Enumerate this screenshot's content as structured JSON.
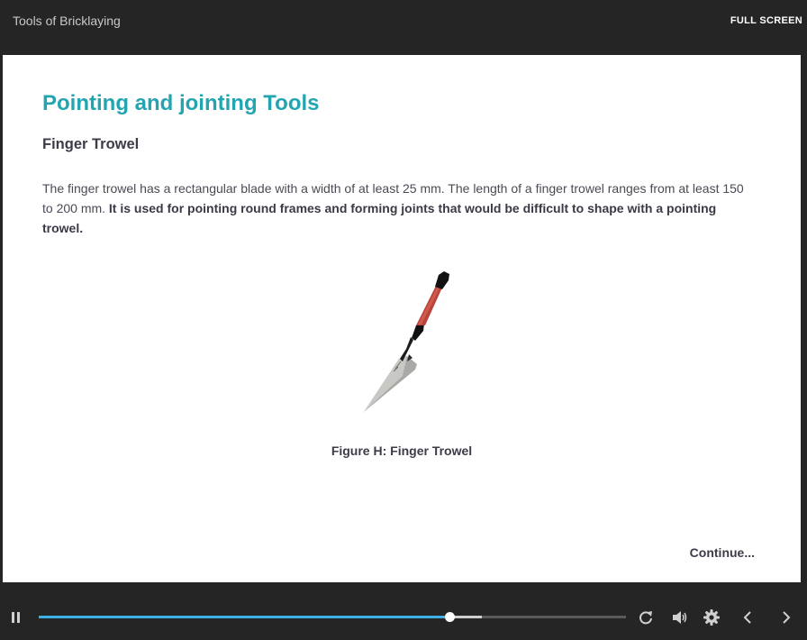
{
  "header": {
    "course_title": "Tools of Bricklaying",
    "fullscreen_label": "FULL SCREEN"
  },
  "slide": {
    "title": "Pointing and jointing Tools",
    "subtitle": "Finger Trowel",
    "body_plain": "The finger trowel has a rectangular blade with a width of at least 25 mm. The length of a finger trowel ranges from at least 150 to 200 mm. ",
    "body_bold": "It is used for pointing round frames and forming joints that would be difficult to shape with a pointing trowel.",
    "figure_caption": "Figure H: Finger Trowel",
    "continue_label": "Continue..."
  },
  "player": {
    "progress_fraction": 0.7,
    "buffered_fraction": 0.755,
    "icons": [
      "pause-icon",
      "replay-icon",
      "volume-icon",
      "settings-icon",
      "prev-icon",
      "next-icon"
    ]
  },
  "colors": {
    "accent_title": "#23a5b1",
    "progress": "#3db1e3",
    "chrome_bg": "#252525"
  }
}
